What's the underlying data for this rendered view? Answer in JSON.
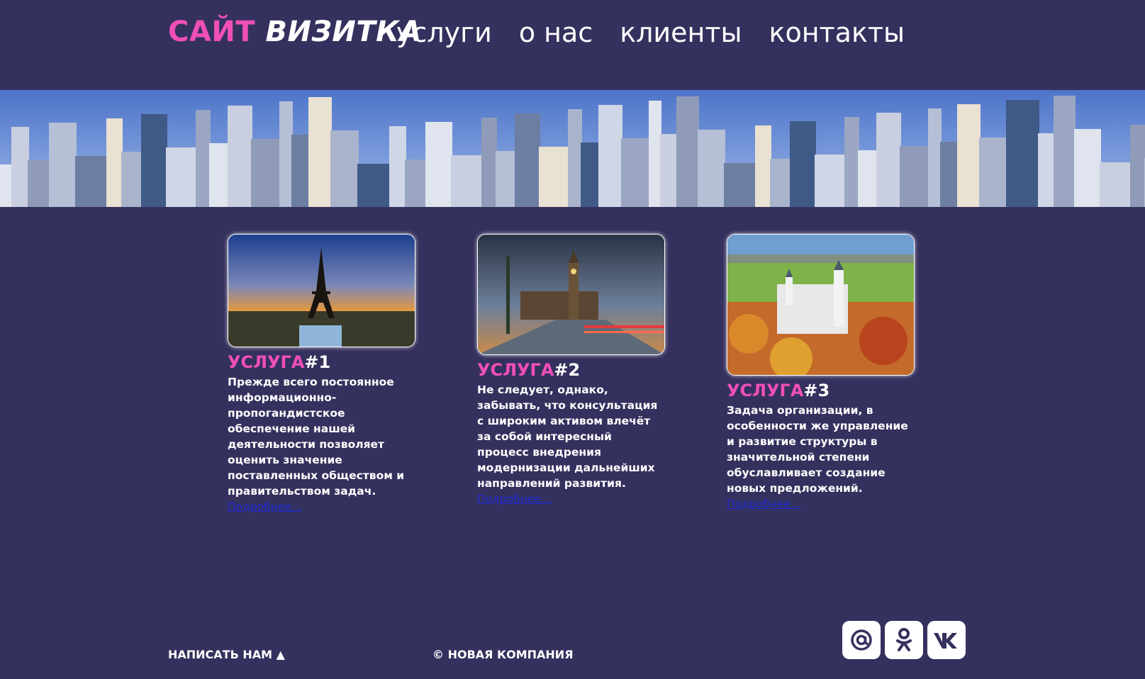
{
  "header": {
    "logo_accent": "САЙТ",
    "logo_rest": "ВИЗИТКА",
    "nav": [
      "услуги",
      "о нас",
      "клиенты",
      "контакты"
    ]
  },
  "cards": [
    {
      "title_accent": "УСЛУГА",
      "title_num": "#1",
      "text": "Прежде всего постоянное информационно-пропогандистское обеспечение нашей деятельности позволяет оценить значение поставленных обществом и правительством задач.",
      "more": "Подробнее..."
    },
    {
      "title_accent": "УСЛУГА",
      "title_num": "#2",
      "text": "Не следует, однако, забывать, что консультация с широким активом влечёт за собой интересный процесс внедрения модернизации дальнейших направлений развития.",
      "more": "Подробнее..."
    },
    {
      "title_accent": "УСЛУГА",
      "title_num": "#3",
      "text": "Задача организации, в особенности же управление и развитие структуры в значительной степени обуславливает создание новых предложений.",
      "more": "Подробнее..."
    }
  ],
  "footer": {
    "write_us": "НАПИСАТЬ НАМ ▲",
    "copyright": "© НОВАЯ КОМПАНИЯ"
  },
  "social": [
    "mail-icon",
    "odnoklassniki-icon",
    "vk-icon"
  ],
  "colors": {
    "background": "#35315e",
    "accent": "#f04fb6",
    "link": "#1e2bd6"
  }
}
